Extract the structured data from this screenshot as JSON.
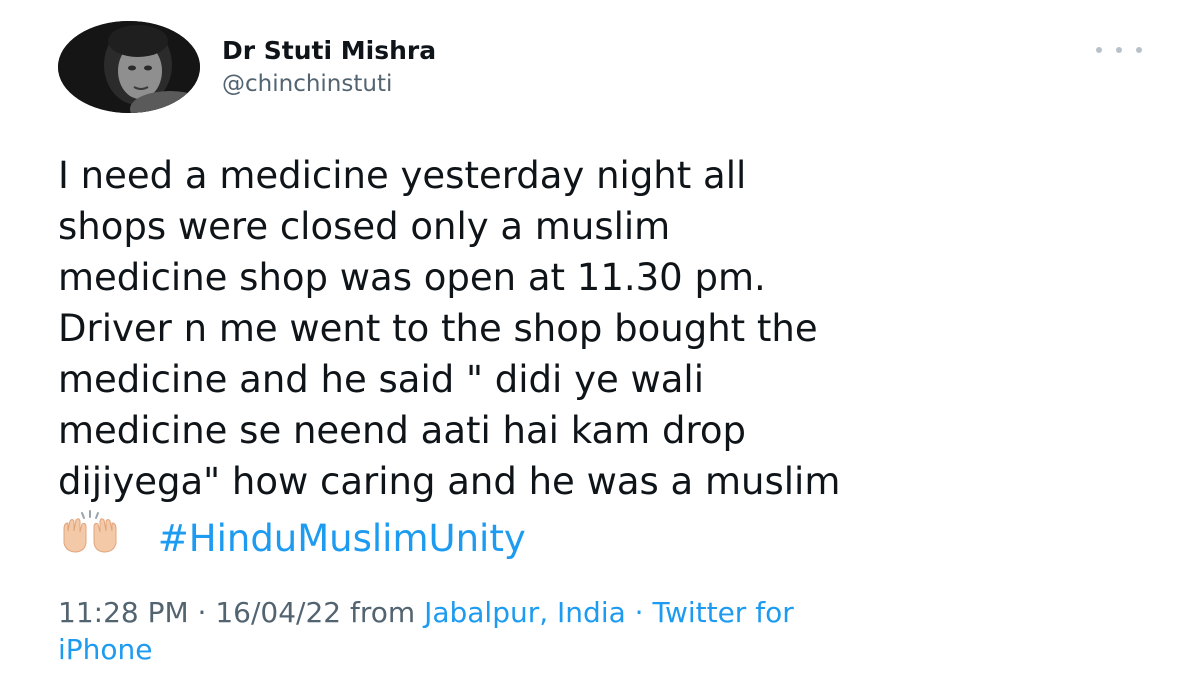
{
  "user": {
    "display_name": "Dr Stuti Mishra",
    "handle": "@chinchinstuti"
  },
  "tweet": {
    "lines": [
      "I need a medicine yesterday night all",
      "shops were closed only a muslim",
      "medicine shop was open at 11.30 pm.",
      "Driver n me went to the shop bought the",
      "medicine and he said \" didi ye wali",
      "medicine se neend aati hai kam drop",
      "dijiyega\" how caring and he was a muslim"
    ],
    "emoji": "raising-hands-emoji",
    "hashtag": "#HinduMuslimUnity"
  },
  "meta": {
    "time": "11:28 PM",
    "separator": " · ",
    "date": "16/04/22",
    "from_label": " from ",
    "location": "Jabalpur, India",
    "separator2": " · ",
    "source_part1": "Twitter for",
    "source_part2": "iPhone"
  },
  "icons": {
    "more": "more-horizontal-icon"
  },
  "colors": {
    "link": "#1d9bf0",
    "secondary_text": "#536471",
    "primary_text": "#0f1419"
  }
}
